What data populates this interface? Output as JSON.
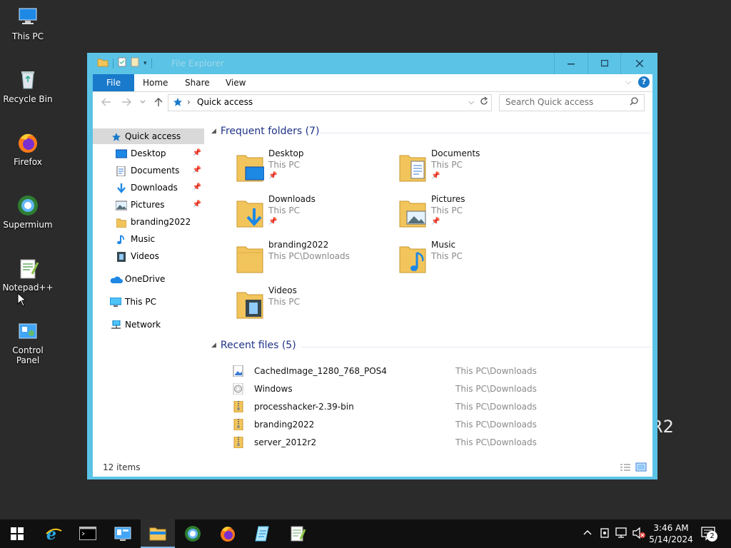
{
  "desktop": {
    "icons": [
      {
        "label": "This PC",
        "icon": "this-pc-icon"
      },
      {
        "label": "Recycle Bin",
        "icon": "recycle-bin-icon"
      },
      {
        "label": "Firefox",
        "icon": "firefox-icon"
      },
      {
        "label": "Supermium",
        "icon": "supermium-icon"
      },
      {
        "label": "Notepad++",
        "icon": "notepadpp-icon"
      },
      {
        "label": "Control Panel",
        "icon": "control-panel-icon"
      }
    ],
    "watermark_text": "R2"
  },
  "window": {
    "title": "File Explorer",
    "ribbon_tabs": [
      "File",
      "Home",
      "Share",
      "View"
    ],
    "address": "Quick access",
    "search_placeholder": "Search Quick access",
    "nav": {
      "quick_access": "Quick access",
      "pinned": [
        "Desktop",
        "Documents",
        "Downloads",
        "Pictures"
      ],
      "unpinned": [
        "branding2022",
        "Music",
        "Videos"
      ],
      "onedrive": "OneDrive",
      "this_pc": "This PC",
      "network": "Network"
    },
    "frequent": {
      "header": "Frequent folders (7)",
      "folders": [
        {
          "name": "Desktop",
          "location": "This PC",
          "pinned": true
        },
        {
          "name": "Documents",
          "location": "This PC",
          "pinned": true
        },
        {
          "name": "Downloads",
          "location": "This PC",
          "pinned": true
        },
        {
          "name": "Pictures",
          "location": "This PC",
          "pinned": true
        },
        {
          "name": "branding2022",
          "location": "This PC\\Downloads",
          "pinned": false
        },
        {
          "name": "Music",
          "location": "This PC",
          "pinned": false
        },
        {
          "name": "Videos",
          "location": "This PC",
          "pinned": false
        }
      ]
    },
    "recent": {
      "header": "Recent files (5)",
      "files": [
        {
          "name": "CachedImage_1280_768_POS4",
          "location": "This PC\\Downloads",
          "icon": "image-file-icon"
        },
        {
          "name": "Windows",
          "location": "This PC\\Downloads",
          "icon": "disc-file-icon"
        },
        {
          "name": "processhacker-2.39-bin",
          "location": "This PC\\Downloads",
          "icon": "zip-folder-icon"
        },
        {
          "name": "branding2022",
          "location": "This PC\\Downloads",
          "icon": "zip-folder-icon"
        },
        {
          "name": "server_2012r2",
          "location": "This PC\\Downloads",
          "icon": "zip-folder-icon"
        }
      ]
    },
    "status": "12 items"
  },
  "taskbar": {
    "apps": [
      "start-icon",
      "internet-explorer-icon",
      "command-prompt-icon",
      "server-manager-icon",
      "file-explorer-icon",
      "supermium-icon",
      "firefox-icon",
      "notepad-icon",
      "notepadpp-icon"
    ],
    "time": "3:46 AM",
    "date": "5/14/2024",
    "notifications": "2"
  },
  "colors": {
    "accent": "#1979ca",
    "title_bar": "#5bc3e6",
    "folder": "#f2c55c",
    "header": "#1e3287"
  }
}
